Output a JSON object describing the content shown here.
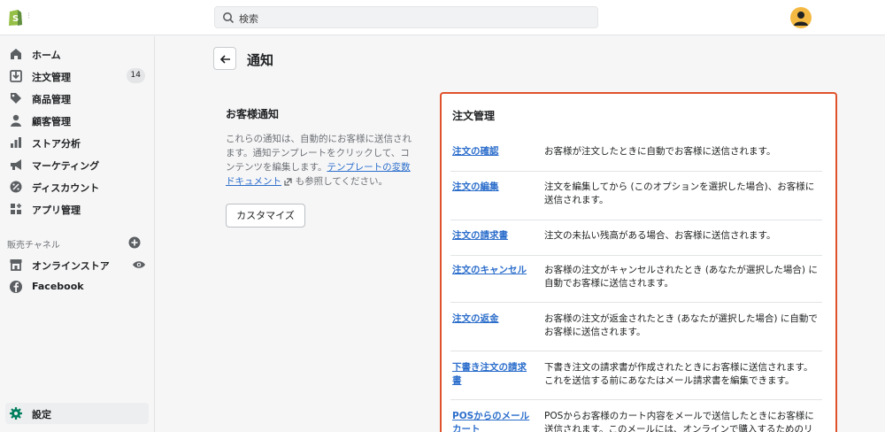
{
  "search": {
    "placeholder": "検索"
  },
  "sidebar": {
    "items": [
      {
        "label": "ホーム"
      },
      {
        "label": "注文管理",
        "badge": "14"
      },
      {
        "label": "商品管理"
      },
      {
        "label": "顧客管理"
      },
      {
        "label": "ストア分析"
      },
      {
        "label": "マーケティング"
      },
      {
        "label": "ディスカウント"
      },
      {
        "label": "アプリ管理"
      }
    ],
    "sales_channels_label": "販売チャネル",
    "channels": [
      {
        "label": "オンラインストア"
      },
      {
        "label": "Facebook"
      }
    ],
    "settings_label": "設定"
  },
  "page": {
    "title": "通知"
  },
  "customer_notifications": {
    "title": "お客様通知",
    "desc_part1": "これらの通知は、自動的にお客様に送信されます。通知テンプレートをクリックして、コンテンツを編集します。",
    "link_text": "テンプレートの変数ドキュメント",
    "desc_part2": " も参照してください。",
    "button_label": "カスタマイズ"
  },
  "orders_card": {
    "title": "注文管理",
    "rows": [
      {
        "link": "注文の確認",
        "desc": "お客様が注文したときに自動でお客様に送信されます。"
      },
      {
        "link": "注文の編集",
        "desc": "注文を編集してから (このオプションを選択した場合)、お客様に送信されます。"
      },
      {
        "link": "注文の請求書",
        "desc": "注文の未払い残高がある場合、お客様に送信されます。"
      },
      {
        "link": "注文のキャンセル",
        "desc": "お客様の注文がキャンセルされたとき (あなたが選択した場合) に自動でお客様に送信されます。"
      },
      {
        "link": "注文の返金",
        "desc": "お客様の注文が返金されたとき (あなたが選択した場合) に自動でお客様に送信されます。"
      },
      {
        "link": "下書き注文の請求書",
        "desc": "下書き注文の請求書が作成されたときにお客様に送信されます。これを送信する前にあなたはメール請求書を編集できます。"
      },
      {
        "link": "POSからのメールカート",
        "desc": "POSからお客様のカート内容をメールで送信したときにお客様に送信されます。このメールには、オンラインで購入するためのリ"
      }
    ]
  },
  "colors": {
    "accent": "#2c6ecb",
    "highlight_border": "#e0522b",
    "brand": "#95bf47"
  }
}
